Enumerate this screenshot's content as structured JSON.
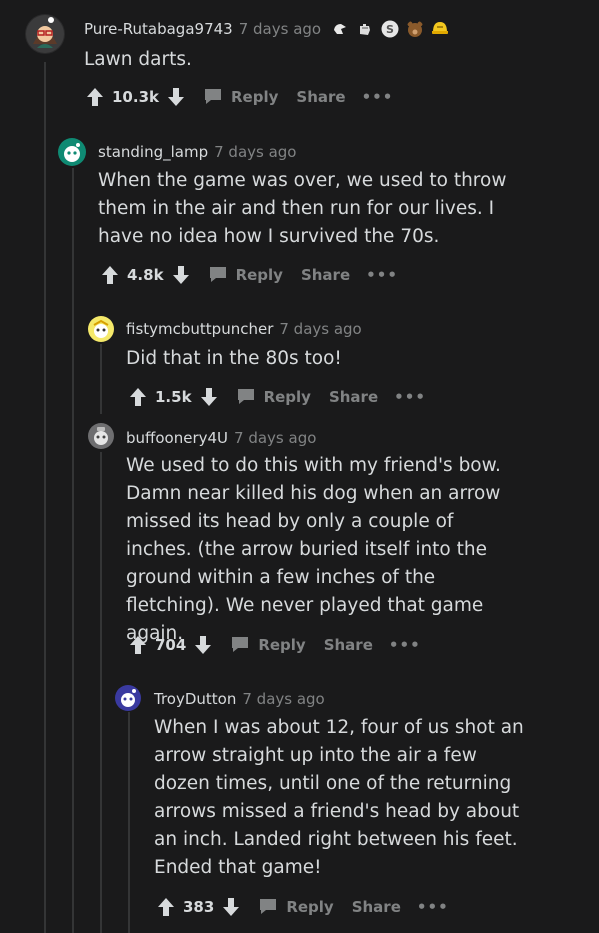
{
  "actions": {
    "reply": "Reply",
    "share": "Share",
    "more": "•••"
  },
  "comments": [
    {
      "username": "Pure-Rutabaga9743",
      "time": "7 days ago",
      "body": "Lawn darts.",
      "score": "10.3k"
    },
    {
      "username": "standing_lamp",
      "time": "7 days ago",
      "body": "When the game was over, we used to throw them in the air and then run for our lives. I have no idea how I survived the 70s.",
      "score": "4.8k"
    },
    {
      "username": "fistymcbuttpuncher",
      "time": "7 days ago",
      "body": "Did that in the 80s too!",
      "score": "1.5k"
    },
    {
      "username": "buffoonery4U",
      "time": "7 days ago",
      "body": "We used to do this with my friend's bow. Damn near killed his dog when an arrow missed its head by only a couple of inches. (the arrow buried itself into the ground within a few inches of the fletching). We never played that game again.",
      "score": "704"
    },
    {
      "username": "TroyDutton",
      "time": "7 days ago",
      "body": "When I was about 12, four of us shot an arrow straight up into the air a few dozen times, until one of the returning arrows missed a friend's head by about an inch. Landed right between his feet. Ended that game!",
      "score": "383"
    }
  ],
  "awards": [
    "white-glove-award-icon",
    "hand-award-icon",
    "silver-coin-award-icon",
    "bear-award-icon",
    "gold-helmet-award-icon"
  ],
  "colors": {
    "background": "#1a1a1b",
    "text": "#d7dadc",
    "muted": "#818384",
    "thread": "#343536"
  }
}
